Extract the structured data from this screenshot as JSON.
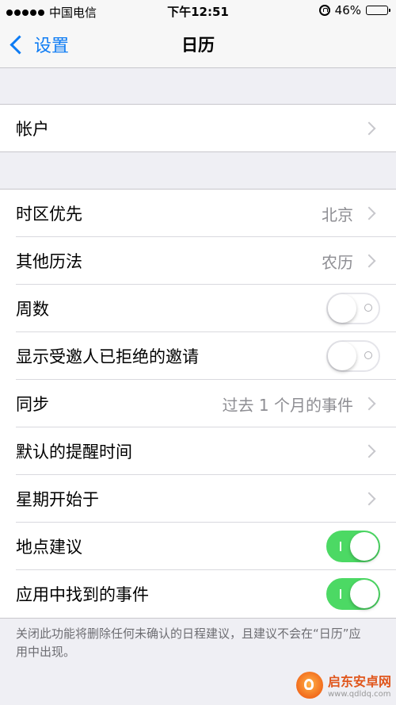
{
  "status_bar": {
    "carrier": "中国电信",
    "time": "下午12:51",
    "battery": "46%",
    "battery_level": 0.46
  },
  "nav": {
    "back_label": "设置",
    "title": "日历"
  },
  "account": {
    "label": "帐户"
  },
  "settings": {
    "timezone": {
      "label": "时区优先",
      "value": "北京"
    },
    "alt_calendar": {
      "label": "其他历法",
      "value": "农历"
    },
    "week_numbers": {
      "label": "周数",
      "on": false
    },
    "show_declined": {
      "label": "显示受邀人已拒绝的邀请",
      "on": false
    },
    "sync": {
      "label": "同步",
      "value": "过去 1 个月的事件"
    },
    "default_alert": {
      "label": "默认的提醒时间"
    },
    "week_start": {
      "label": "星期开始于"
    },
    "location_suggestions": {
      "label": "地点建议",
      "on": true
    },
    "events_found": {
      "label": "应用中找到的事件",
      "on": true
    }
  },
  "footer_note": "关闭此功能将删除任何未确认的日程建议，且建议不会在“日历”应用中出现。",
  "watermark": {
    "title": "启东安卓网",
    "url": "www.qdldq.com"
  },
  "colors": {
    "accent": "#0e7cf4",
    "toggle_on": "#4cd964",
    "secondary_text": "#8e8e93"
  }
}
